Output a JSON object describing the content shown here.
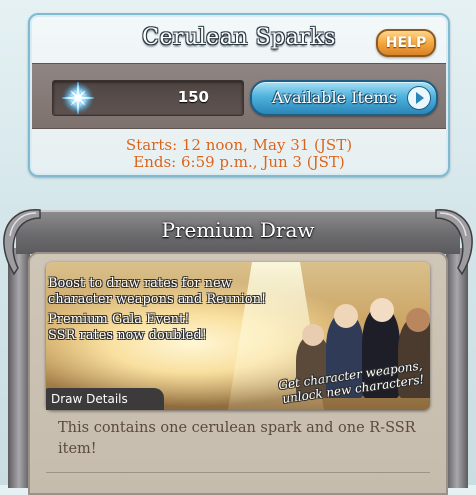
{
  "spark_panel": {
    "title": "Cerulean Sparks",
    "help_label": "HELP",
    "spark_count": "150",
    "available_button": "Available Items",
    "starts": "Starts: 12 noon, May 31 (JST)",
    "ends": "Ends: 6:59 p.m., Jun 3 (JST)",
    "accent_color": "#4fb2dd",
    "date_color": "#d9631a"
  },
  "premium_draw": {
    "title": "Premium Draw",
    "banner_lines": [
      "Boost to draw rates for new",
      "character weapons and Reunion!",
      "Premium Gala Event!",
      "SSR rates now doubled!"
    ],
    "banner_tagline_1": "Get character weapons,",
    "banner_tagline_2": "unlock new characters!",
    "details_label": "Draw Details",
    "description": "This contains one cerulean spark and one R-SSR item!"
  }
}
